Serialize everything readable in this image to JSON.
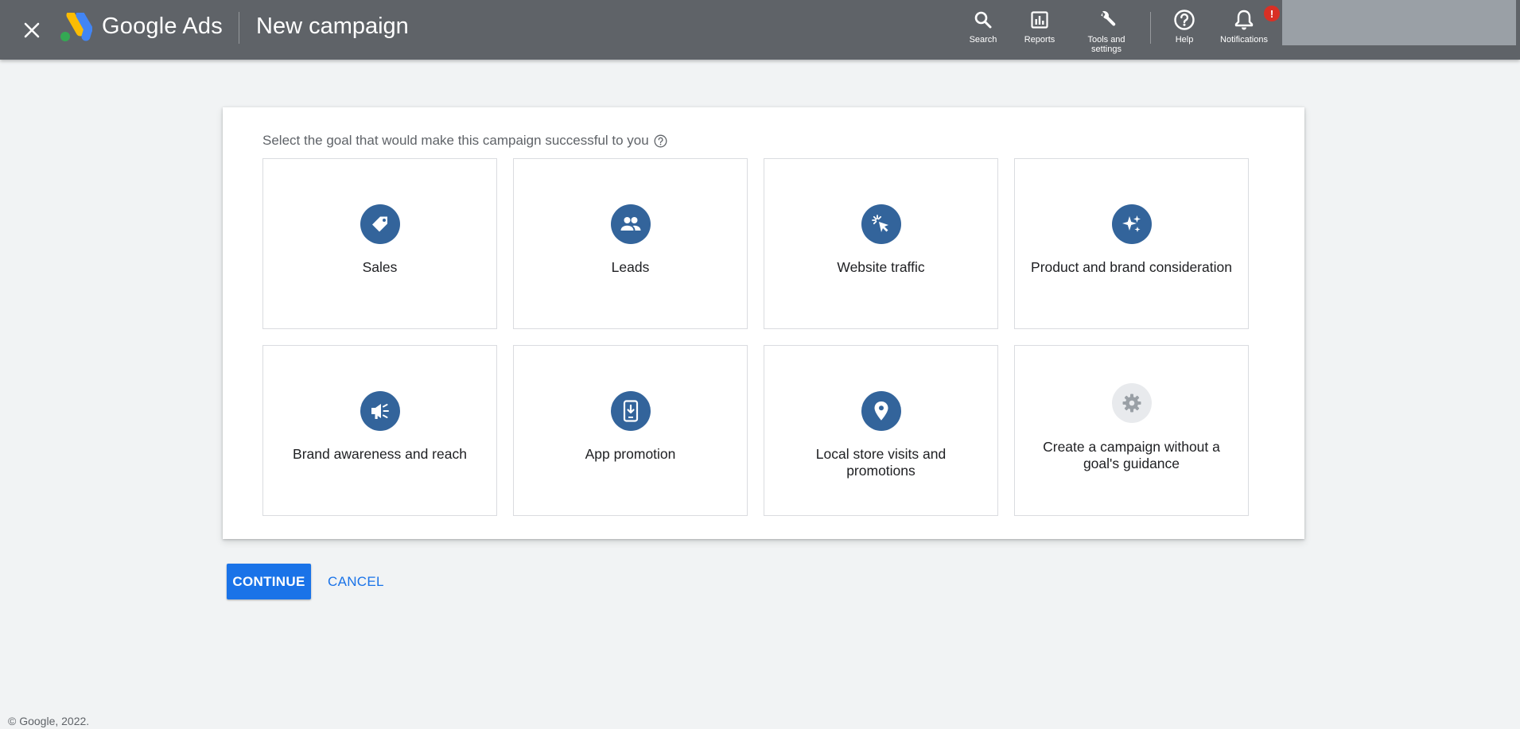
{
  "header": {
    "brand": "Google Ads",
    "page_title": "New campaign",
    "tools": [
      {
        "label": "Search",
        "icon": "search-icon"
      },
      {
        "label": "Reports",
        "icon": "reports-icon"
      },
      {
        "label": "Tools and settings",
        "icon": "wrench-icon"
      },
      {
        "label": "Help",
        "icon": "help-icon"
      },
      {
        "label": "Notifications",
        "icon": "bell-icon",
        "badge": "!"
      }
    ],
    "bar_color": "#5f6368"
  },
  "main": {
    "prompt": "Select the goal that would make this campaign successful to you",
    "goals": [
      {
        "label": "Sales",
        "icon": "tag-icon"
      },
      {
        "label": "Leads",
        "icon": "people-icon"
      },
      {
        "label": "Website traffic",
        "icon": "cursor-click-icon"
      },
      {
        "label": "Product and brand consideration",
        "icon": "sparkle-icon"
      },
      {
        "label": "Brand awareness and reach",
        "icon": "megaphone-icon"
      },
      {
        "label": "App promotion",
        "icon": "phone-download-icon"
      },
      {
        "label": "Local store visits and promotions",
        "icon": "location-pin-icon"
      },
      {
        "label": "Create a campaign without a goal's guidance",
        "icon": "gear-icon"
      }
    ],
    "goal_icon_color": "#33649b"
  },
  "actions": {
    "continue_label": "CONTINUE",
    "cancel_label": "CANCEL",
    "accent": "#1a73e8"
  },
  "footer": {
    "copyright": "© Google, 2022."
  }
}
